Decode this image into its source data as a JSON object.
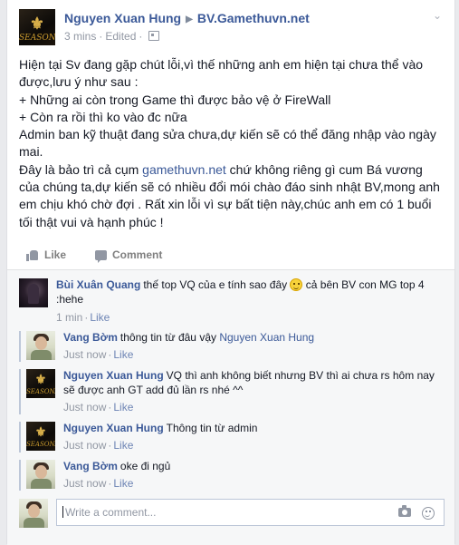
{
  "post": {
    "author": "Nguyen Xuan Hung",
    "target_page": "BV.Gamethuvn.net",
    "time": "3 mins",
    "separator": "·",
    "edited": "Edited",
    "avatar_logo_prefix": "SEASON",
    "avatar_logo_suffix": "X",
    "avatar_emblem": "⚜",
    "body": {
      "line1": "Hiện tại Sv đang gặp chút lỗi,vì thế những anh em hiện tại chưa thể vào được,lưu ý như sau :",
      "line2": "+ Những ai còn trong Game thì được bảo vệ ở FireWall",
      "line3": "+ Còn ra rồi thì ko vào đc nữa",
      "line4": "Admin ban kỹ thuật đang sửa chưa,dự kiến sẽ có thể đăng nhập vào ngày mai.",
      "line5_before": "Đây là bảo trì cả cụm ",
      "line5_link": "gamethuvn.net",
      "line5_after": " chứ không riêng gì cum Bá vương của chúng ta,dự kiến sẽ có nhiều đổi mói chào đáo sinh nhật BV,mong anh em chịu khó chờ đợi . Rất xin lỗi vì sự bất tiện này,chúc anh em có 1 buổi tối thật vui và hạnh phúc !"
    }
  },
  "actions": {
    "like": "Like",
    "comment": "Comment"
  },
  "comments": [
    {
      "author": "Bùi Xuân Quang",
      "text_before": "thế top VQ của e tính sao đây ",
      "text_after": " cả bên BV con MG top 4 :hehe",
      "time": "1 min",
      "like": "Like"
    },
    {
      "author": "Vang Bờm",
      "text": "thông tin từ đâu vậy ",
      "mention": "Nguyen Xuan Hung",
      "time": "Just now",
      "like": "Like"
    },
    {
      "author": "Nguyen Xuan Hung",
      "text": "VQ thì anh không biết nhưng BV thì ai chưa rs hôm nay sẽ được anh GT add đủ lần rs nhé ^^",
      "time": "Just now",
      "like": "Like"
    },
    {
      "author": "Nguyen Xuan Hung",
      "text": "Thông tin từ admin",
      "time": "Just now",
      "like": "Like"
    },
    {
      "author": "Vang Bờm",
      "text": "oke đi ngủ",
      "time": "Just now",
      "like": "Like"
    }
  ],
  "composer": {
    "placeholder": "Write a comment..."
  },
  "colors": {
    "link": "#3b5998",
    "meta": "#9197a3",
    "background": "#e9eaed"
  }
}
